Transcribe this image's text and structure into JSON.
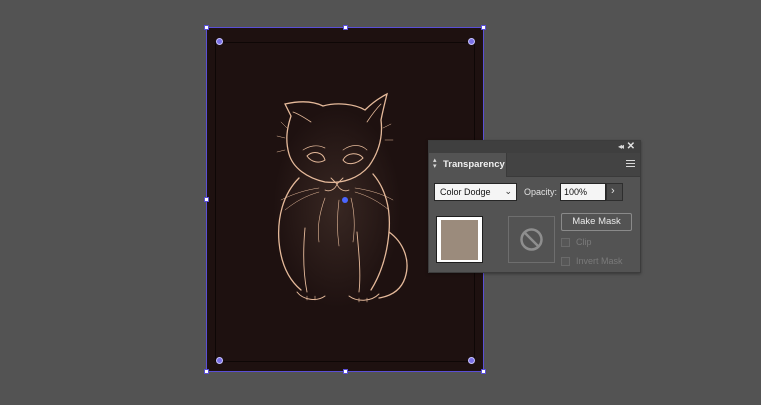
{
  "panel": {
    "tab_label": "Transparency",
    "collapse_icon": "double-chevron-left-icon",
    "close_icon": "close-icon",
    "menu_icon": "panel-menu-icon",
    "blend_mode": "Color Dodge",
    "opacity_label": "Opacity:",
    "opacity_value": "100%",
    "make_mask_label": "Make Mask",
    "clip_label": "Clip",
    "invert_mask_label": "Invert Mask",
    "clip_checked": false,
    "invert_mask_checked": false,
    "thumbnail_color": "#9b8b7c"
  },
  "colors": {
    "workspace_bg": "#535353",
    "artboard_bg": "#1e1110",
    "selection": "#5a4fd6",
    "panel_bg": "#535353"
  }
}
